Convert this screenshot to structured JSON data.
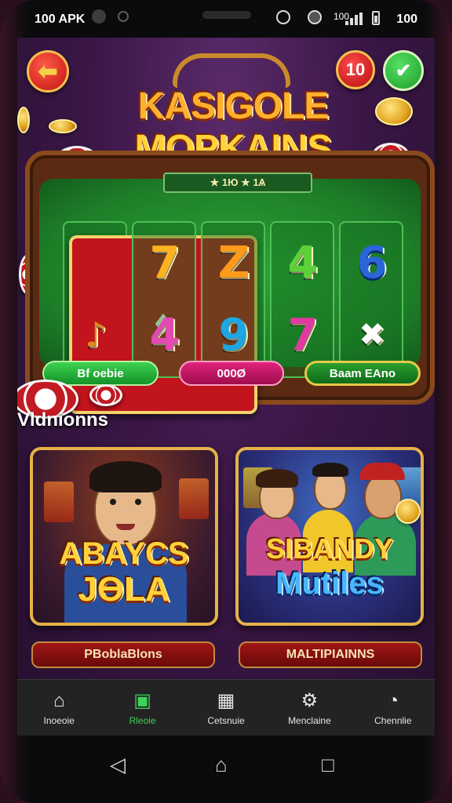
{
  "status_bar": {
    "left_text": "100 APK",
    "right_text": "100",
    "right_small": "100"
  },
  "header": {
    "back_icon": "arrow-left-icon",
    "notification_count": "10",
    "confirm_icon": "check-icon",
    "title_line1": "KASIGOLE",
    "title_line2": "MOPKAINS",
    "table_plaque": "★ 1Ю ★ 1Ѧ"
  },
  "slot": {
    "reels": [
      {
        "top": "♦",
        "bottom": "♪",
        "top_type": "card",
        "bottom_type": "horn",
        "top_color": "#ffffff",
        "bottom_color": "#d98a22"
      },
      {
        "top": "7",
        "bottom": "4",
        "top_color": "#ffb21f",
        "bottom_color": "#e34bb2"
      },
      {
        "top": "Z",
        "bottom": "9",
        "top_color": "#ff9a1a",
        "bottom_color": "#1fa6e0"
      },
      {
        "top": "4",
        "bottom": "7",
        "top_color": "#5ed13a",
        "bottom_color": "#e03aa0"
      },
      {
        "top": "6",
        "bottom": "✖",
        "top_color": "#2a66d9",
        "bottom_color": "#ffffff",
        "bottom_type": "dice"
      }
    ],
    "buttons": {
      "left": "Bf oebie",
      "center": "000Ø",
      "right": "Baam EAno"
    }
  },
  "section": {
    "title": "Vldnionns"
  },
  "cards": [
    {
      "line1": "ABAYCS",
      "line2": "JƟLA",
      "button": "PBoblaBlons"
    },
    {
      "line1": "SIBANDY",
      "line2": "Mutiles",
      "button": "MALTIPIAINNS"
    }
  ],
  "bottom_nav": [
    {
      "label": "Inoeoie",
      "icon": "home-icon",
      "glyph": "⌂"
    },
    {
      "label": "Rleoie",
      "icon": "wallet-icon",
      "glyph": "▣",
      "active": true
    },
    {
      "label": "Cetsnuie",
      "icon": "calculator-icon",
      "glyph": "▦"
    },
    {
      "label": "Menclaine",
      "icon": "gear-icon",
      "glyph": "⚙"
    },
    {
      "label": "Chennlie",
      "icon": "profile-icon",
      "glyph": "◔"
    }
  ],
  "system_nav": {
    "back_icon": "android-back-icon",
    "home_icon": "android-home-icon",
    "recents_icon": "android-recents-icon"
  },
  "colors": {
    "background": "#3b1747",
    "felt": "#1d7d28",
    "gold": "#e7b14a",
    "nav_active": "#3fd35a"
  }
}
